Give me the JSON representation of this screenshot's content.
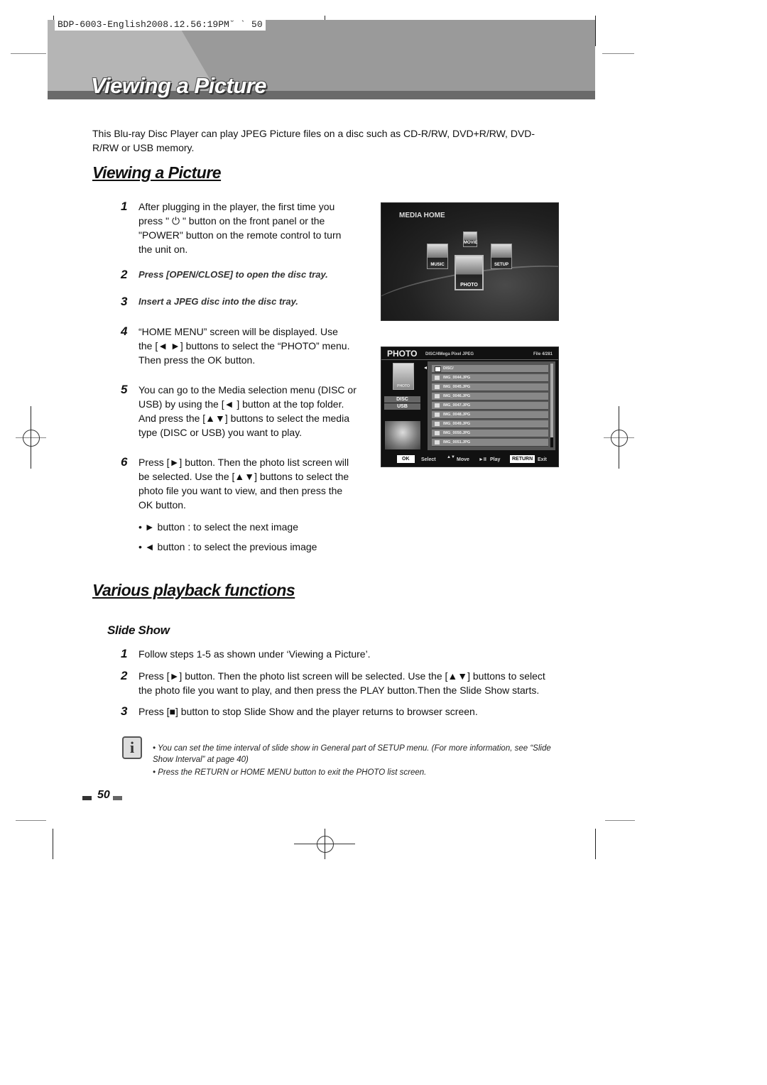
{
  "print_slug": "BDP-6003-English2008.12.56:19PM˘  ˋ  50",
  "banner": {
    "title": "Viewing a Picture"
  },
  "intro": "This Blu-ray Disc Player can play JPEG Picture files on a disc such as CD-R/RW, DVD+R/RW, DVD-R/RW or USB memory.",
  "section1": {
    "heading": "Viewing a Picture",
    "steps": [
      {
        "num": "1",
        "text": "After plugging in the player, the first time you press \" ⏻ \" button on the front panel or the \"POWER\" button on the remote control to turn the unit on."
      },
      {
        "num": "2",
        "text": "Press [OPEN/CLOSE] to open the disc tray."
      },
      {
        "num": "3",
        "text": "Insert a JPEG disc into the disc tray."
      },
      {
        "num": "4",
        "text": "“HOME MENU” screen will be displayed. Use the [◄ ►] buttons to select the “PHOTO” menu. Then press the OK button."
      },
      {
        "num": "5",
        "text": "You can go to the Media selection menu (DISC or USB) by using the [◄ ] button at the top folder. And press the [▲▼] buttons to select the media type (DISC or USB) you want to play."
      },
      {
        "num": "6",
        "text": "Press [►] button. Then the photo list screen will be selected. Use the  [▲▼] buttons to select the photo file you want to view, and then press the OK button."
      }
    ],
    "bullets": [
      "• ► button : to select the next image",
      "• ◄ button : to select the previous image"
    ]
  },
  "media_home": {
    "title": "MEDIA HOME",
    "icons": [
      {
        "label": "MOVIE",
        "icon": "movie-icon"
      },
      {
        "label": "MUSIC",
        "icon": "music-icon"
      },
      {
        "label": "SETUP",
        "icon": "setup-icon"
      },
      {
        "label": "PHOTO",
        "icon": "photo-icon",
        "selected": true
      }
    ]
  },
  "photo_list": {
    "title": "PHOTO",
    "path": "DISC/4Mega Pixel JPEG",
    "count": "File 4/281",
    "thumb_label": "PHOTO",
    "media": [
      "DISC",
      "USB"
    ],
    "files": [
      "DISC/",
      "IMG_0044.JPG",
      "IMG_0045.JPG",
      "IMG_0046.JPG",
      "IMG_0047.JPG",
      "IMG_0048.JPG",
      "IMG_0049.JPG",
      "IMG_0050.JPG",
      "IMG_0051.JPG"
    ],
    "footer": {
      "ok_key": "OK",
      "ok_label": "Select",
      "move_key": "▲▼",
      "move_label": "Move",
      "play_key": "►II",
      "play_label": "Play",
      "return_key": "RETURN",
      "return_label": "Exit"
    }
  },
  "section2": {
    "heading": "Various playback functions",
    "subheading": "Slide Show",
    "steps": [
      {
        "num": "1",
        "text": "Follow steps 1-5 as shown under ‘Viewing a Picture’."
      },
      {
        "num": "2",
        "text": "Press [►] button. Then the photo list screen will be selected. Use the  [▲▼] buttons to select the photo file you want to play, and then press the PLAY button.Then the Slide Show starts."
      },
      {
        "num": "3",
        "text": "Press [■] button to stop Slide Show and the player returns to browser screen."
      }
    ]
  },
  "notes": [
    "• You can set the time interval of slide show in General  part of  SETUP menu.  (For more information, see “Slide Show Interval” at page 40)",
    "• Press the RETURN or HOME MENU button to exit the PHOTO list screen."
  ],
  "page_number": "50"
}
